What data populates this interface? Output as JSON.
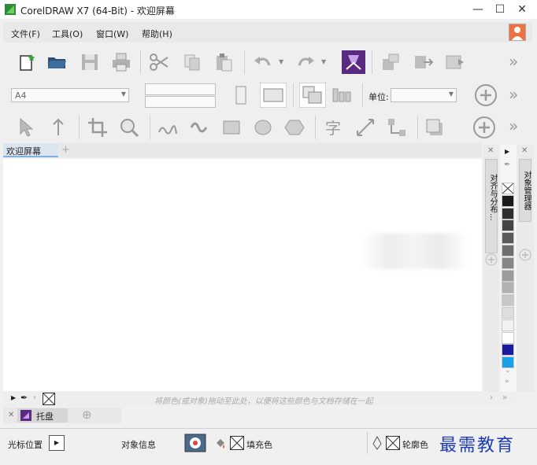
{
  "window": {
    "title": "CorelDRAW X7 (64-Bit) - 欢迎屏幕",
    "minimize": "—",
    "maximize": "☐",
    "close": "✕"
  },
  "menu": {
    "items": [
      "文件(F)",
      "工具(O)",
      "窗口(W)",
      "帮助(H)"
    ]
  },
  "property_bar": {
    "page_size": "A4",
    "unit_label": "单位:",
    "unit_value": ""
  },
  "tabs": {
    "welcome": "欢迎屏幕"
  },
  "right_panels": {
    "align_distribute": "对齐与分布...",
    "object_manager": "对象管理器"
  },
  "palette": {
    "colors": [
      "#ffffff",
      "#1a1a1a",
      "#2e2e2e",
      "#444444",
      "#5a5a5a",
      "#6f6f6f",
      "#858585",
      "#9b9b9b",
      "#b1b1b1",
      "#c7c7c7",
      "#dddddd",
      "#f2f2f2",
      "#ffffff",
      "#1a1a9e",
      "#1aa0e8"
    ]
  },
  "status_strip": {
    "hint": "将颜色(或对象)拖动至此处，以便将这些颜色与文档存储在一起"
  },
  "tray": {
    "label": "托盘"
  },
  "statusbar": {
    "cursor_position": "光标位置",
    "object_info": "对象信息",
    "fill_color": "填充色",
    "outline_color": "轮廓色"
  },
  "watermark": "最需教育"
}
